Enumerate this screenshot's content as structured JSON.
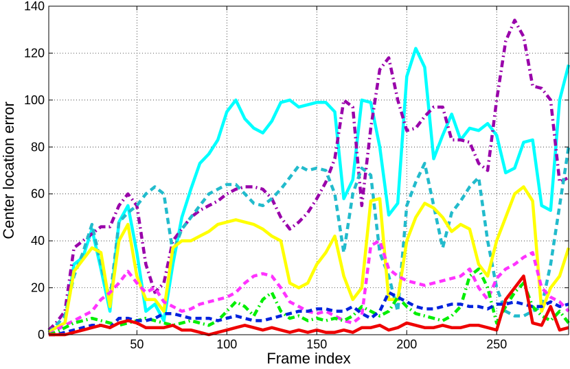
{
  "chart_data": {
    "type": "line",
    "xlabel": "Frame index",
    "ylabel": "Center location error",
    "xlim": [
      1,
      290
    ],
    "ylim": [
      0,
      140
    ],
    "xticks": [
      50,
      100,
      150,
      200,
      250
    ],
    "yticks": [
      0,
      20,
      40,
      60,
      80,
      100,
      120,
      140
    ],
    "grid": true,
    "series": [
      {
        "color": "#00ffff",
        "style": "solid",
        "x": [
          1,
          5,
          10,
          15,
          20,
          25,
          30,
          35,
          40,
          45,
          50,
          55,
          60,
          65,
          70,
          75,
          80,
          85,
          90,
          95,
          100,
          105,
          110,
          115,
          120,
          125,
          130,
          135,
          140,
          145,
          150,
          155,
          160,
          165,
          170,
          175,
          180,
          185,
          190,
          195,
          200,
          205,
          210,
          215,
          220,
          225,
          230,
          235,
          240,
          245,
          250,
          255,
          260,
          265,
          270,
          275,
          280,
          285,
          290
        ],
        "y": [
          1,
          3,
          5,
          30,
          33,
          45,
          28,
          10,
          48,
          55,
          35,
          10,
          13,
          6,
          30,
          50,
          62,
          73,
          77,
          83,
          95,
          100,
          92,
          88,
          86,
          91,
          99,
          100,
          97,
          98,
          99,
          99,
          95,
          58,
          66,
          100,
          99,
          80,
          51,
          56,
          110,
          122,
          114,
          75,
          85,
          94,
          83,
          88,
          87,
          90,
          85,
          69,
          71,
          82,
          83,
          55,
          53,
          100,
          115
        ]
      },
      {
        "color": "#9900aa",
        "style": "dashdot",
        "x": [
          1,
          5,
          10,
          15,
          20,
          25,
          30,
          35,
          40,
          45,
          50,
          55,
          60,
          65,
          70,
          75,
          80,
          85,
          90,
          95,
          100,
          105,
          110,
          115,
          120,
          125,
          130,
          135,
          140,
          145,
          150,
          155,
          160,
          165,
          170,
          175,
          180,
          185,
          190,
          195,
          200,
          205,
          210,
          215,
          220,
          225,
          230,
          235,
          240,
          245,
          250,
          255,
          260,
          265,
          270,
          275,
          280,
          285,
          290
        ],
        "y": [
          2,
          5,
          10,
          37,
          40,
          43,
          46,
          46,
          55,
          60,
          55,
          30,
          18,
          22,
          40,
          45,
          50,
          53,
          55,
          57,
          60,
          62,
          63,
          63,
          62,
          58,
          50,
          45,
          48,
          52,
          58,
          65,
          75,
          100,
          97,
          55,
          88,
          113,
          118,
          100,
          87,
          88,
          93,
          97,
          97,
          83,
          83,
          82,
          73,
          70,
          100,
          125,
          134,
          127,
          106,
          105,
          100,
          65,
          67
        ]
      },
      {
        "color": "#22bbcc",
        "style": "dashed",
        "x": [
          1,
          5,
          10,
          15,
          20,
          25,
          30,
          35,
          40,
          45,
          50,
          55,
          60,
          65,
          70,
          75,
          80,
          85,
          90,
          95,
          100,
          105,
          110,
          115,
          120,
          125,
          130,
          135,
          140,
          145,
          150,
          155,
          160,
          165,
          170,
          175,
          180,
          185,
          190,
          195,
          200,
          205,
          210,
          215,
          220,
          225,
          230,
          235,
          240,
          245,
          250,
          255,
          260,
          265,
          270,
          275,
          280,
          285,
          290
        ],
        "y": [
          1,
          4,
          8,
          25,
          35,
          47,
          30,
          15,
          48,
          52,
          55,
          60,
          63,
          60,
          35,
          45,
          50,
          55,
          60,
          62,
          64,
          64,
          60,
          56,
          55,
          58,
          62,
          67,
          72,
          70,
          71,
          70,
          60,
          35,
          60,
          71,
          68,
          35,
          25,
          10,
          55,
          65,
          73,
          55,
          37,
          52,
          57,
          63,
          67,
          40,
          20,
          10,
          8,
          8,
          10,
          12,
          30,
          55,
          80
        ]
      },
      {
        "color": "#ffff00",
        "style": "solid",
        "x": [
          1,
          5,
          10,
          15,
          20,
          25,
          30,
          35,
          40,
          45,
          50,
          55,
          60,
          65,
          70,
          75,
          80,
          85,
          90,
          95,
          100,
          105,
          110,
          115,
          120,
          125,
          130,
          135,
          140,
          145,
          150,
          155,
          160,
          165,
          170,
          175,
          180,
          185,
          190,
          195,
          200,
          205,
          210,
          215,
          220,
          225,
          230,
          235,
          240,
          245,
          250,
          255,
          260,
          265,
          270,
          275,
          280,
          285,
          290
        ],
        "y": [
          1,
          3,
          5,
          27,
          32,
          37,
          35,
          12,
          40,
          47,
          25,
          15,
          15,
          10,
          37,
          40,
          40,
          42,
          44,
          47,
          48,
          49,
          48,
          47,
          45,
          42,
          40,
          22,
          20,
          22,
          30,
          35,
          42,
          25,
          15,
          20,
          57,
          58,
          15,
          15,
          40,
          50,
          56,
          54,
          50,
          44,
          47,
          45,
          30,
          25,
          40,
          50,
          60,
          63,
          57,
          10,
          20,
          25,
          37
        ]
      },
      {
        "color": "#ff33ff",
        "style": "dashed",
        "x": [
          1,
          5,
          10,
          15,
          20,
          25,
          30,
          35,
          40,
          45,
          50,
          55,
          60,
          65,
          70,
          75,
          80,
          85,
          90,
          95,
          100,
          105,
          110,
          115,
          120,
          125,
          130,
          135,
          140,
          145,
          150,
          155,
          160,
          165,
          170,
          175,
          180,
          185,
          190,
          195,
          200,
          205,
          210,
          215,
          220,
          225,
          230,
          235,
          240,
          245,
          250,
          255,
          260,
          265,
          270,
          275,
          280,
          285,
          290
        ],
        "y": [
          0,
          2,
          4,
          6,
          8,
          10,
          15,
          18,
          22,
          27,
          22,
          18,
          20,
          14,
          12,
          10,
          11,
          13,
          14,
          15,
          16,
          18,
          22,
          25,
          26,
          25,
          20,
          14,
          12,
          10,
          9,
          10,
          8,
          6,
          5,
          8,
          38,
          40,
          28,
          25,
          23,
          22,
          21,
          22,
          23,
          24,
          25,
          28,
          20,
          15,
          24,
          28,
          30,
          33,
          35,
          20,
          16,
          14,
          10
        ]
      },
      {
        "color": "#00ee00",
        "style": "dashdot",
        "x": [
          1,
          5,
          10,
          15,
          20,
          25,
          30,
          35,
          40,
          45,
          50,
          55,
          60,
          65,
          70,
          75,
          80,
          85,
          90,
          95,
          100,
          105,
          110,
          115,
          120,
          125,
          130,
          135,
          140,
          145,
          150,
          155,
          160,
          165,
          170,
          175,
          180,
          185,
          190,
          195,
          200,
          205,
          210,
          215,
          220,
          225,
          230,
          235,
          240,
          245,
          250,
          255,
          260,
          265,
          270,
          275,
          280,
          285,
          290
        ],
        "y": [
          0,
          1,
          3,
          5,
          6,
          7,
          6,
          5,
          4,
          5,
          6,
          7,
          6,
          5,
          4,
          5,
          6,
          5,
          4,
          6,
          10,
          14,
          12,
          8,
          15,
          18,
          10,
          7,
          8,
          6,
          7,
          6,
          7,
          6,
          8,
          12,
          10,
          8,
          10,
          16,
          12,
          9,
          8,
          7,
          6,
          8,
          12,
          25,
          28,
          20,
          5,
          12,
          18,
          22,
          12,
          8,
          6,
          10,
          5
        ]
      },
      {
        "color": "#0022dd",
        "style": "dashed",
        "x": [
          1,
          5,
          10,
          15,
          20,
          25,
          30,
          35,
          40,
          45,
          50,
          55,
          60,
          65,
          70,
          75,
          80,
          85,
          90,
          95,
          100,
          105,
          110,
          115,
          120,
          125,
          130,
          135,
          140,
          145,
          150,
          155,
          160,
          165,
          170,
          175,
          180,
          185,
          190,
          195,
          200,
          205,
          210,
          215,
          220,
          225,
          230,
          235,
          240,
          245,
          250,
          255,
          260,
          265,
          270,
          275,
          280,
          285,
          290
        ],
        "y": [
          0,
          0,
          1,
          2,
          3,
          4,
          4,
          3,
          7,
          7,
          6,
          6,
          7,
          9,
          9,
          8,
          7,
          7,
          7,
          6,
          7,
          8,
          7,
          6,
          6,
          7,
          8,
          9,
          10,
          10,
          11,
          11,
          10,
          10,
          12,
          9,
          7,
          10,
          18,
          16,
          14,
          12,
          11,
          11,
          12,
          13,
          13,
          12,
          12,
          11,
          13,
          13,
          14,
          13,
          12,
          12,
          14,
          12,
          13
        ]
      },
      {
        "color": "#ee0000",
        "style": "solid",
        "x": [
          1,
          5,
          10,
          15,
          20,
          25,
          30,
          35,
          40,
          45,
          50,
          55,
          60,
          65,
          70,
          75,
          80,
          85,
          90,
          95,
          100,
          105,
          110,
          115,
          120,
          125,
          130,
          135,
          140,
          145,
          150,
          155,
          160,
          165,
          170,
          175,
          180,
          185,
          190,
          195,
          200,
          205,
          210,
          215,
          220,
          225,
          230,
          235,
          240,
          245,
          250,
          255,
          260,
          265,
          270,
          275,
          280,
          285,
          290
        ],
        "y": [
          0,
          0,
          0,
          1,
          2,
          3,
          4,
          3,
          5,
          6,
          5,
          3,
          3,
          3,
          4,
          2,
          2,
          1,
          0,
          1,
          2,
          3,
          4,
          3,
          2,
          3,
          2,
          1,
          2,
          1,
          2,
          1,
          1,
          2,
          1,
          3,
          3,
          4,
          2,
          3,
          5,
          4,
          3,
          3,
          4,
          3,
          3,
          4,
          4,
          3,
          2,
          15,
          20,
          25,
          5,
          4,
          12,
          2,
          3
        ]
      }
    ]
  }
}
